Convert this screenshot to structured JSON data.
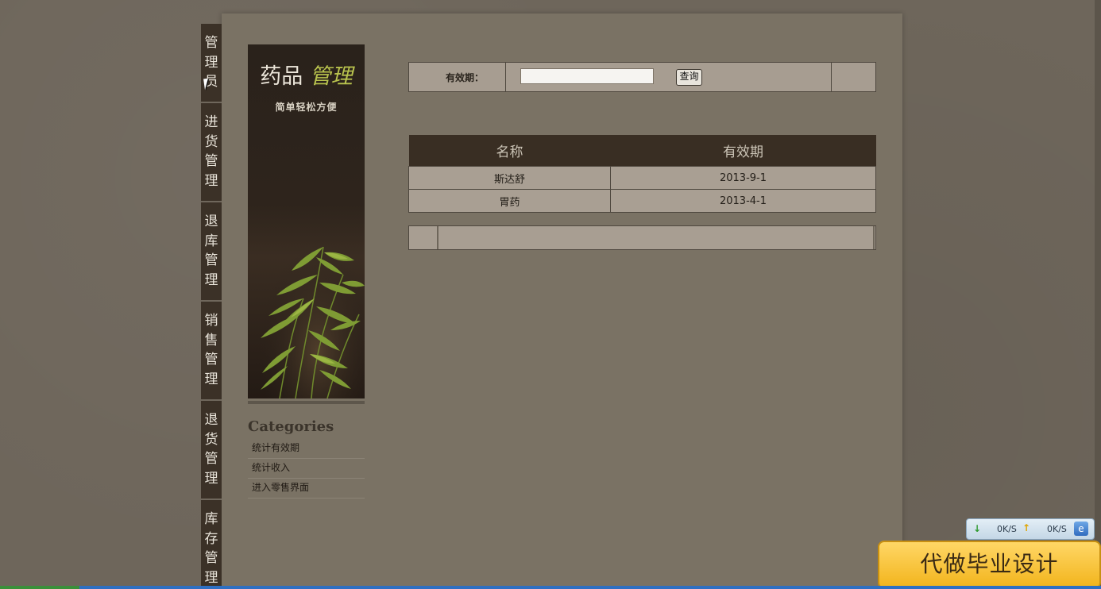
{
  "side_tabs": [
    {
      "id": "admin",
      "label": "管理员",
      "chars": [
        "管",
        "理",
        "员"
      ]
    },
    {
      "id": "purchase",
      "label": "进货管理",
      "chars": [
        "进",
        "货",
        "管",
        "理"
      ]
    },
    {
      "id": "stock-return",
      "label": "退库管理",
      "chars": [
        "退",
        "库",
        "管",
        "理"
      ]
    },
    {
      "id": "sales",
      "label": "销售管理",
      "chars": [
        "销",
        "售",
        "管",
        "理"
      ]
    },
    {
      "id": "goods-return",
      "label": "退货管理",
      "chars": [
        "退",
        "货",
        "管",
        "理"
      ]
    },
    {
      "id": "inventory",
      "label": "库存管理",
      "chars": [
        "库",
        "存",
        "管",
        "理"
      ]
    }
  ],
  "banner": {
    "title_main": "药品",
    "title_accent": "管理",
    "subtitle": "简单轻松方便"
  },
  "categories": {
    "title": "Categories",
    "items": [
      "统计有效期",
      "统计收入",
      "进入零售界面"
    ]
  },
  "search": {
    "label": "有效期：",
    "value": "",
    "button": "查询"
  },
  "table": {
    "headers": [
      "名称",
      "有效期"
    ],
    "rows": [
      [
        "斯达舒",
        "2013-9-1"
      ],
      [
        "胃药",
        "2013-4-1"
      ]
    ]
  },
  "speed_widget": {
    "down": "0K/S",
    "up": "0K/S",
    "icon": "network-icon"
  },
  "promo": {
    "text": "代做毕业设计"
  },
  "colors": {
    "panel": "#7a7264",
    "tab_bg": "#3b3127",
    "table_header": "#392e23",
    "table_cell": "#a99f93",
    "accent_green": "#b9c34e"
  }
}
